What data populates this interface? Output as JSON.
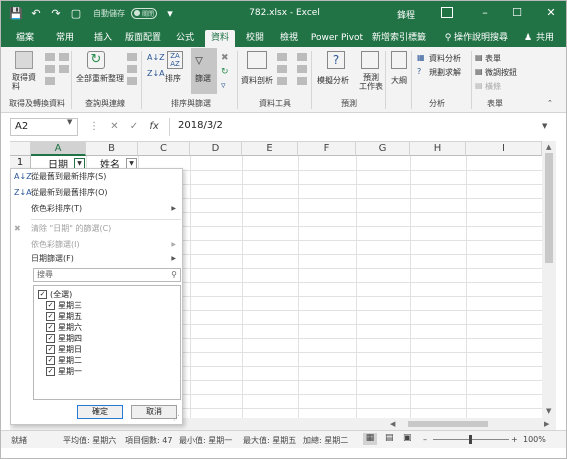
{
  "window": {
    "title": "782.xlsx  -  Excel",
    "user": "鋒程",
    "autosave_label": "自動儲存",
    "autosave_state": "關閉"
  },
  "tabs": [
    "檔案",
    "常用",
    "插入",
    "版面配置",
    "公式",
    "資料",
    "校閱",
    "檢視",
    "Power Pivot",
    "新增索引標籤",
    "操作說明搜尋",
    "共用"
  ],
  "active_tab": "資料",
  "ribbon": {
    "get_data": "取得資\n料",
    "refresh_all": "全部重新整理",
    "sort": "排序",
    "filter": "篩選",
    "text_to_columns": "資料剖析",
    "what_if": "模擬分析",
    "forecast_sheet": "預測\n工作表",
    "outline": "大綱",
    "data_analysis": "資料分析",
    "solver": "規劃求解",
    "table": "表單",
    "ungroup_form": "微調按鈕",
    "group_form": "橫條",
    "groups": [
      "取得及轉換資料",
      "查詢與連線",
      "排序與篩選",
      "資料工具",
      "預測",
      "分析",
      "表單"
    ]
  },
  "formula_bar": {
    "name_box": "A2",
    "fx": "fx",
    "value": "2018/3/2"
  },
  "columns": [
    "A",
    "B",
    "C",
    "D",
    "E",
    "F",
    "G",
    "H",
    "I"
  ],
  "rows": [
    "1"
  ],
  "cells": {
    "A1": "日期",
    "B1": "姓名"
  },
  "filter_menu": {
    "sort_asc": "從最舊到最新排序(S)",
    "sort_desc": "從最新到最舊排序(O)",
    "sort_color": "依色彩排序(T)",
    "clear_filter": "清除 \"日期\" 的篩選(C)",
    "filter_color": "依色彩篩選(I)",
    "date_filters": "日期篩選(F)",
    "search_placeholder": "搜尋",
    "items": [
      "(全選)",
      "星期三",
      "星期五",
      "星期六",
      "星期四",
      "星期日",
      "星期二",
      "星期一"
    ],
    "ok": "確定",
    "cancel": "取消"
  },
  "status_bar": {
    "ready": "就緒",
    "average": "平均值: 星期六",
    "count": "項目個數: 47",
    "min": "最小值: 星期一",
    "max": "最大值: 星期五",
    "sum": "加總: 星期二",
    "zoom": "100%"
  },
  "colors": {
    "brand": "#217346",
    "ribbon_bg": "#f3f3f3"
  }
}
